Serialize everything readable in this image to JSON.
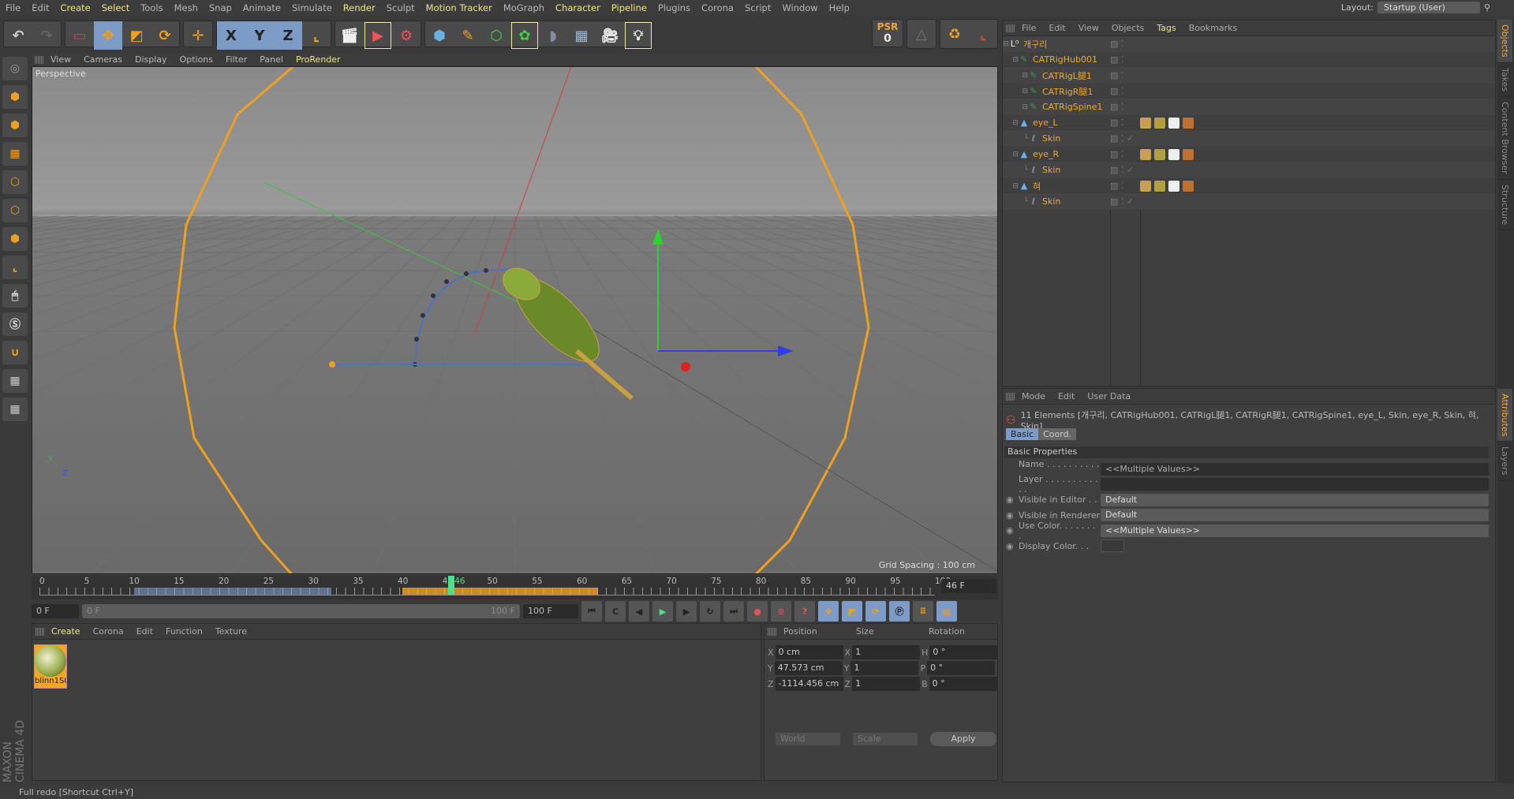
{
  "menu": [
    "File",
    "Edit",
    "Create",
    "Select",
    "Tools",
    "Mesh",
    "Snap",
    "Animate",
    "Simulate",
    "Render",
    "Sculpt",
    "Motion Tracker",
    "MoGraph",
    "Character",
    "Pipeline",
    "Plugins",
    "Corona",
    "Script",
    "Window",
    "Help"
  ],
  "menu_highlighted": [
    "Create",
    "Select",
    "Render",
    "Motion Tracker",
    "Character",
    "Pipeline"
  ],
  "layout": {
    "label": "Layout:",
    "value": "Startup (User)"
  },
  "toolbar": {
    "axis_x": "X",
    "axis_y": "Y",
    "axis_z": "Z",
    "psr_label": "PSR",
    "psr_value": "0"
  },
  "viewport": {
    "menu": [
      "View",
      "Cameras",
      "Display",
      "Options",
      "Filter",
      "Panel",
      "ProRender"
    ],
    "camera": "Perspective",
    "grid_spacing": "Grid Spacing : 100 cm",
    "axis_y": "Y",
    "axis_z": "Z"
  },
  "timeline": {
    "ticks": [
      "0",
      "5",
      "10",
      "15",
      "20",
      "25",
      "30",
      "35",
      "40",
      "45",
      "46",
      "50",
      "55",
      "60",
      "65",
      "70",
      "75",
      "80",
      "85",
      "90",
      "95",
      "100"
    ],
    "current_frame": "46 F",
    "current_frame_value": 46,
    "start": "0 F",
    "slider_start": "0 F",
    "slider_end": "100 F",
    "end": "100 F"
  },
  "material_manager": {
    "menu": [
      "Create",
      "Corona",
      "Edit",
      "Function",
      "Texture"
    ],
    "materials": [
      {
        "name": "blinn1SG"
      }
    ]
  },
  "coordinates": {
    "headers": [
      "Position",
      "Size",
      "Rotation"
    ],
    "rows": [
      {
        "axis": "X",
        "pos": "0 cm",
        "saxis": "X",
        "size": "1",
        "raxis": "H",
        "rot": "0 °"
      },
      {
        "axis": "Y",
        "pos": "47.573 cm",
        "saxis": "Y",
        "size": "1",
        "raxis": "P",
        "rot": "0 °"
      },
      {
        "axis": "Z",
        "pos": "-1114.456 cm",
        "saxis": "Z",
        "size": "1",
        "raxis": "B",
        "rot": "0 °"
      }
    ],
    "mode": "World",
    "size_mode": "Scale",
    "apply": "Apply"
  },
  "status": "Full redo [Shortcut Ctrl+Y]",
  "logo": "MAXON CINEMA 4D",
  "object_manager": {
    "menu": [
      "File",
      "Edit",
      "View",
      "Objects",
      "Tags",
      "Bookmarks"
    ],
    "objects": [
      {
        "name": "개구리",
        "icon": "null-icon",
        "depth": 0
      },
      {
        "name": "CATRigHub001",
        "icon": "cat-rig-icon",
        "depth": 1
      },
      {
        "name": "CATRigL腿1",
        "icon": "cat-rig-icon",
        "depth": 2
      },
      {
        "name": "CATRigR腿1",
        "icon": "cat-rig-icon",
        "depth": 2
      },
      {
        "name": "CATRigSpine1",
        "icon": "cat-rig-icon",
        "depth": 2
      },
      {
        "name": "eye_L",
        "icon": "polygon-icon",
        "depth": 1
      },
      {
        "name": "Skin",
        "icon": "skin-icon",
        "depth": 2
      },
      {
        "name": "eye_R",
        "icon": "polygon-icon",
        "depth": 1
      },
      {
        "name": "Skin",
        "icon": "skin-icon",
        "depth": 2
      },
      {
        "name": "혀",
        "icon": "polygon-icon",
        "depth": 1
      },
      {
        "name": "Skin",
        "icon": "skin-icon",
        "depth": 2
      }
    ]
  },
  "attributes": {
    "menu": [
      "Mode",
      "Edit",
      "User Data"
    ],
    "title": "11 Elements [개구리, CATRigHub001, CATRigL腿1, CATRigR腿1, CATRigSpine1, eye_L, Skin, eye_R, Skin, 혀, Skin]",
    "tabs": [
      "Basic",
      "Coord."
    ],
    "section": "Basic Properties",
    "fields": [
      {
        "label": "Name . . . . . . . . . . .",
        "value": "<<Multiple Values>>"
      },
      {
        "label": "Layer . . . . . . . . . . . .",
        "value": ""
      },
      {
        "label": "Visible in Editor . .",
        "value": "Default"
      },
      {
        "label": "Visible in Renderer",
        "value": "Default"
      },
      {
        "label": "Use Color. . . . . . . .",
        "value": "<<Multiple Values>>"
      },
      {
        "label": "Display Color. . .",
        "value": ""
      }
    ]
  },
  "side_tabs": [
    "Objects",
    "Takes",
    "Content Browser",
    "Structure"
  ],
  "side_tabs2": [
    "Attributes",
    "Layers"
  ],
  "colors": {
    "accent": "#f0a830",
    "menu_highlight": "#f0e68c",
    "active_button": "#7d9bc7"
  }
}
